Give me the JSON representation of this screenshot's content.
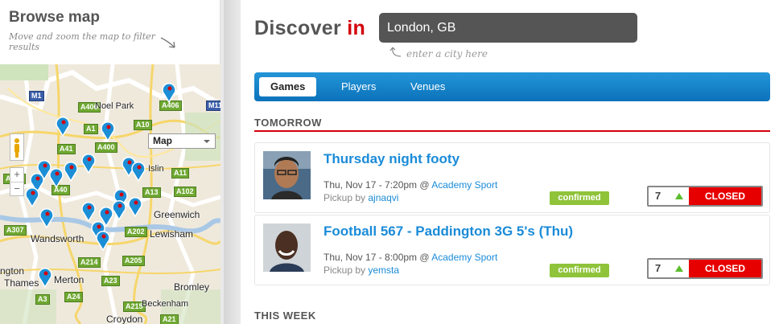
{
  "sidebar": {
    "title": "Browse map",
    "subtitle": "Move and zoom the map to filter results",
    "map_type": "Map",
    "zoom_in": "+",
    "zoom_out": "−",
    "roads": [
      "M1",
      "A406",
      "A1",
      "A10",
      "A41",
      "A400",
      "A406",
      "A40",
      "A11",
      "A13",
      "A102",
      "A307",
      "A202",
      "A214",
      "A205",
      "A23",
      "A24",
      "A3",
      "A215",
      "A21",
      "A406",
      "M11"
    ],
    "places": [
      "Noel Park",
      "Islin",
      "Greenwich",
      "Lewisham",
      "Wandsworth",
      "Merton",
      "Bromley",
      "Beckenham",
      "Croydon",
      "Thames",
      "ngton"
    ]
  },
  "header": {
    "discover": "Discover",
    "in": "in",
    "city": "London, GB",
    "hint": "enter a city here"
  },
  "tabs": [
    {
      "label": "Games"
    },
    {
      "label": "Players"
    },
    {
      "label": "Venues"
    }
  ],
  "sections": {
    "tomorrow": "TOMORROW",
    "this_week": "THIS WEEK"
  },
  "games": [
    {
      "title": "Thursday night footy",
      "datetime": "Thu, Nov 17 - 7:20pm @",
      "venue": "Academy Sport",
      "pickup_label": "Pickup by",
      "organizer": "ajnaqvi",
      "badge": "confirmed",
      "count": "7",
      "status": "CLOSED"
    },
    {
      "title": "Football 567 - Paddington 3G 5's (Thu)",
      "datetime": "Thu, Nov 17 - 8:00pm @",
      "venue": "Academy Sport",
      "pickup_label": "Pickup by",
      "organizer": "yemsta",
      "badge": "confirmed",
      "count": "7",
      "status": "CLOSED"
    }
  ],
  "colors": {
    "accent": "#1a8bd8",
    "brand_red": "#d3000a",
    "closed": "#e60000",
    "confirmed": "#8fc33a"
  }
}
